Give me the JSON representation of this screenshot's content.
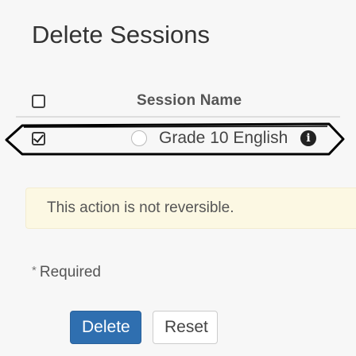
{
  "page": {
    "title": "Delete Sessions"
  },
  "table": {
    "column_header": "Session Name",
    "rows": [
      {
        "name": "Grade 10 English",
        "checked": true
      }
    ]
  },
  "warning": {
    "text": "This action is not reversible."
  },
  "form": {
    "required_marker": "*",
    "required_label": "Required"
  },
  "buttons": {
    "delete_label": "Delete",
    "reset_label": "Reset"
  },
  "icons": {
    "info": "info-icon",
    "checkbox_checked": "checkbox-checked-icon",
    "checkbox_empty": "checkbox-empty-icon",
    "radio": "radio-icon"
  },
  "colors": {
    "primary": "#2f6fb0",
    "warning_bg": "#fcf8e3",
    "annotation": "#000000"
  }
}
